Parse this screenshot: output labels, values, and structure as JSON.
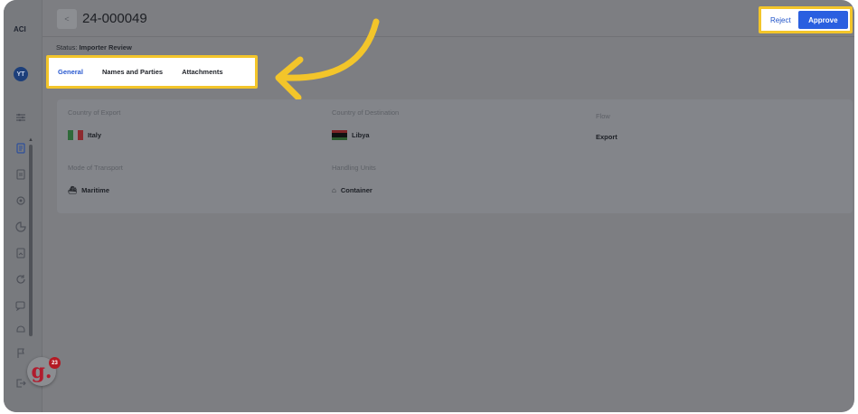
{
  "rail": {
    "logo": "ACI",
    "avatar_initials": "YT",
    "badge_count": "23",
    "badge_letter": "g."
  },
  "header": {
    "document_id": "24-000049",
    "status_label": "Status:",
    "status_value": "Importer Review"
  },
  "actions": {
    "reject_label": "Reject",
    "approve_label": "Approve"
  },
  "tabs": [
    {
      "label": "General",
      "active": true
    },
    {
      "label": "Names and Parties",
      "active": false
    },
    {
      "label": "Attachments",
      "active": false
    }
  ],
  "fields": {
    "country_of_export": {
      "label": "Country of Export",
      "value": "Italy"
    },
    "country_of_destination": {
      "label": "Country of Destination",
      "value": "Libya"
    },
    "flow": {
      "label": "Flow",
      "value": "Export"
    },
    "mode_of_transport": {
      "label": "Mode of Transport",
      "value": "Maritime"
    },
    "handling_units": {
      "label": "Handling Units",
      "value": "Container"
    }
  },
  "colors": {
    "highlight": "#f3c52a",
    "accent": "#2a5fe0",
    "overlay": "#7d7e82"
  }
}
